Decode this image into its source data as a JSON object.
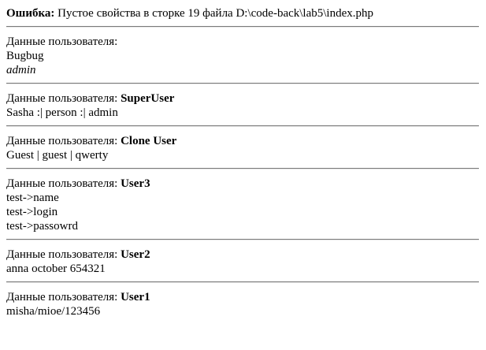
{
  "error": {
    "label": "Ошибка:",
    "message": " Пустое свойства в сторке 19 файла D:\\code-back\\lab5\\index.php"
  },
  "user_label": "Данные пользователя:",
  "users": [
    {
      "class_name": "",
      "lines": [
        "Bugbug"
      ],
      "italic_line": "admin"
    },
    {
      "class_name": "SuperUser",
      "lines": [
        "Sasha :| person :| admin"
      ]
    },
    {
      "class_name": "Clone User",
      "lines": [
        "Guest | guest | qwerty"
      ]
    },
    {
      "class_name": "User3",
      "lines": [
        "test->name",
        "test->login",
        "test->passowrd"
      ]
    },
    {
      "class_name": "User2",
      "lines": [
        "anna october 654321"
      ]
    },
    {
      "class_name": "User1",
      "lines": [
        "misha/mioe/123456"
      ]
    }
  ]
}
